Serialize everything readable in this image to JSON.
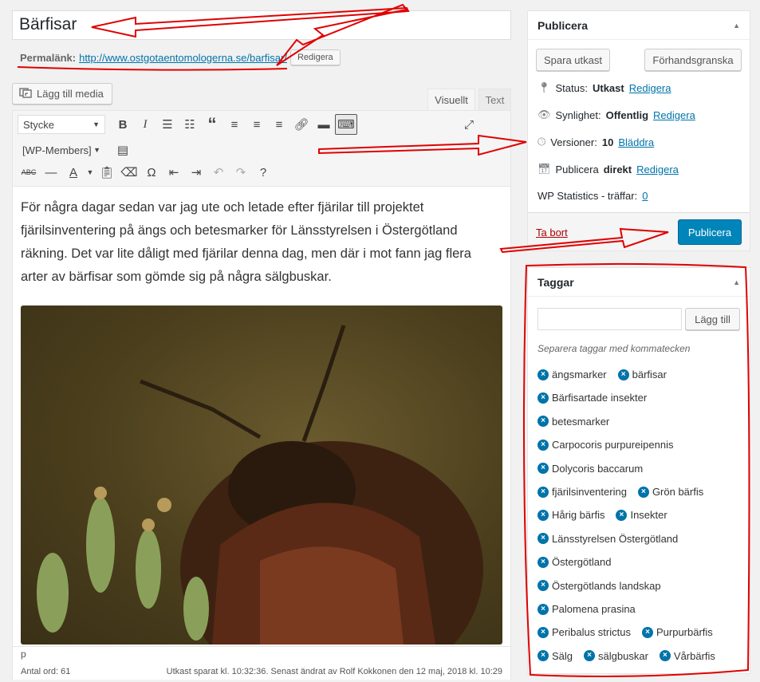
{
  "post": {
    "title": "Bärfisar",
    "permalink_label": "Permalänk:",
    "permalink_url": "http://www.ostgotaentomologerna.se/barfisar/",
    "permalink_edit": "Redigera"
  },
  "editor": {
    "add_media_label": "Lägg till media",
    "tabs": [
      "Visuellt",
      "Text"
    ],
    "format_select": "Stycke",
    "shortcode_select": "[WP-Members]",
    "content_paragraph": "För några dagar sedan var jag ute och letade efter fjärilar till projektet fjärilsinventering på ängs och betesmarker för Länsstyrelsen i Östergötland räkning. Det var lite dåligt med fjärilar denna dag, men där i mot fann jag flera arter av bärfisar som gömde sig på några sälgbuskar.",
    "path": "p",
    "word_count": "Antal ord: 61",
    "save_status": "Utkast sparat kl. 10:32:36. Senast ändrat av Rolf Kokkonen den 12 maj, 2018 kl. 10:29"
  },
  "publish_box": {
    "title": "Publicera",
    "save_draft": "Spara utkast",
    "preview": "Förhandsgranska",
    "status_label": "Status:",
    "status_value": "Utkast",
    "status_edit": "Redigera",
    "visibility_label": "Synlighet:",
    "visibility_value": "Offentlig",
    "visibility_edit": "Redigera",
    "revisions_label": "Versioner:",
    "revisions_value": "10",
    "revisions_link": "Bläddra",
    "publish_label": "Publicera",
    "publish_value": "direkt",
    "publish_edit": "Redigera",
    "stats_label": "WP Statistics - träffar:",
    "stats_value": "0",
    "trash": "Ta bort",
    "publish_button": "Publicera"
  },
  "tags_box": {
    "title": "Taggar",
    "add_button": "Lägg till",
    "hint": "Separera taggar med kommatecken",
    "tag_rows": [
      [
        "ängsmarker",
        "bärfisar"
      ],
      [
        "Bärfisartade insekter"
      ],
      [
        "betesmarker"
      ],
      [
        "Carpocoris purpureipennis"
      ],
      [
        "Dolycoris baccarum"
      ],
      [
        "fjärilsinventering",
        "Grön bärfis"
      ],
      [
        "Hårig bärfis",
        "Insekter"
      ],
      [
        "Länsstyrelsen Östergötland"
      ],
      [
        "Östergötland"
      ],
      [
        "Östergötlands landskap"
      ],
      [
        "Palomena prasina"
      ],
      [
        "Peribalus strictus",
        "Purpurbärfis"
      ],
      [
        "Sälg",
        "sälgbuskar",
        "Vårbärfis"
      ]
    ]
  },
  "colors": {
    "link": "#0073aa",
    "primary_button": "#0085ba",
    "annotation": "#e00000"
  }
}
